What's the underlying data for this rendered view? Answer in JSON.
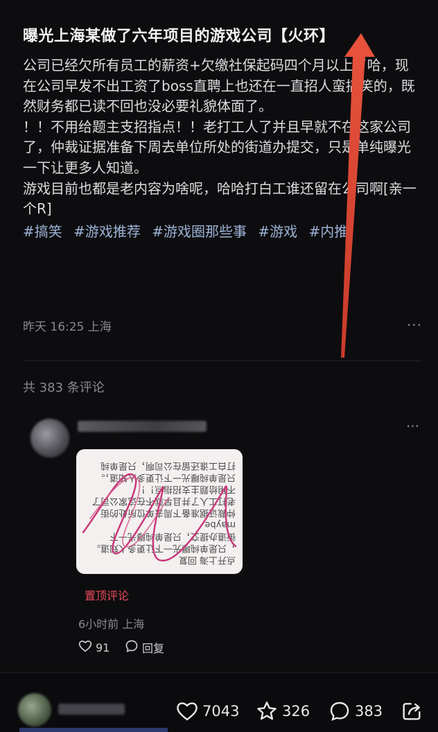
{
  "post": {
    "title": "曝光上海某做了六年项目的游戏公司【火环】",
    "paragraphs": [
      "公司已经欠所有员工的薪资+欠缴社保起码四个月以上了哈，现在公司早发不出工资了boss直聘上也还在一直招人蛮搞笑的，既然财务都已读不回也没必要礼貌体面了。",
      "！！不用给题主支招指点！！老打工人了并且早就不在这家公司了，仲裁证据准备下周去单位所处的街道办提交，只是单纯曝光一下让更多人知道。",
      "游戏目前也都是老内容为啥呢，哈哈打白工谁还留在公司啊[亲一个R]"
    ],
    "tags": [
      "#搞笑",
      "#游戏推荐",
      "#游戏圈那些事",
      "#游戏",
      "#内推"
    ],
    "meta": "昨天 16:25 上海",
    "more_icon": "···"
  },
  "comments": {
    "count_label": "共 383 条评论",
    "first": {
      "image_text": "点开上海 回复\n，只是单纯曝光一下让更多人知道。\n街道办提交，只是单纯曝光一下maybe\n仲裁证据准备下周去单位所处的街\n老打工人了并且早就不在这家公司了\n不用给题主支招指点！！\n只是单纯曝光一下让更多人知道，。\n打白工谁还留在公司啊，只是单纯",
      "pinned_label": "置顶评论",
      "time": "6小时前 上海",
      "likes": "91",
      "reply_label": "回复",
      "more_icon": "···"
    }
  },
  "bottom": {
    "likes": "7043",
    "favorites": "326",
    "comments": "383"
  },
  "colors": {
    "background": "#0d0d0f",
    "tag": "#9eb3d6",
    "pinned": "#ee4b5a",
    "arrow": "#e8533d"
  }
}
